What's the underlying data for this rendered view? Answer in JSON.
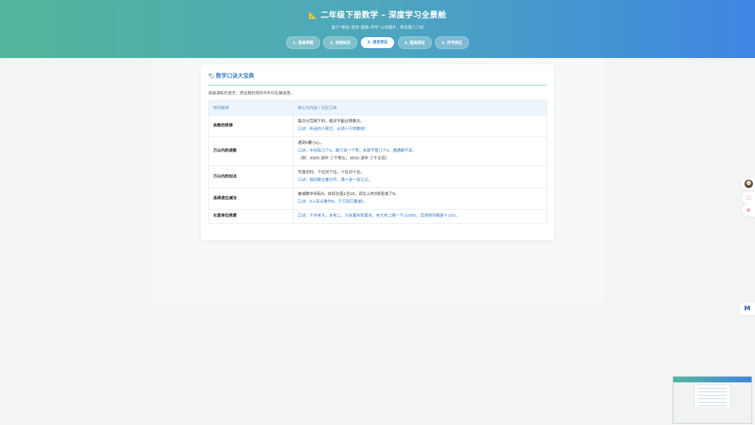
{
  "header": {
    "title": "二年级下册数学 – 深度学习全景舱",
    "subtitle": "基于“体验–语言–图画–符号”认知循环 · 青岛版六三制",
    "tabs": [
      {
        "label": "1. 思维导图",
        "active": false
      },
      {
        "label": "2. 体验知识",
        "active": false
      },
      {
        "label": "3. 语言表征",
        "active": true
      },
      {
        "label": "4. 图画表征",
        "active": false
      },
      {
        "label": "5. 符号表征",
        "active": false
      }
    ]
  },
  "card": {
    "title": "数学口诀大宝典",
    "description": "用最凝练的语言，把运算的规则牢牢印在脑海里。",
    "table": {
      "headers": [
        "知识板块",
        "核心大白话 / 记忆口诀"
      ],
      "rows": [
        {
          "topic": "余数的铁律",
          "lines": [
            {
              "text": "每次分完剩下的，绝对不能比除数大。",
              "rhyme": false
            },
            {
              "text": "口诀：听话的小尾巴，必须小于除数他！",
              "rhyme": true
            }
          ]
        },
        {
          "topic": "万以内的读数",
          "lines": [
            {
              "text": "遇到0要小心。",
              "rhyme": false
            },
            {
              "text": "口诀：中间有几个0，都只读一个零；末尾不管几个0，通通都不读。",
              "rhyme": true
            },
            {
              "text": "（例：3005 读作 三千零五；3500 读作 三千五百）",
              "rhyme": false
            }
          ]
        },
        {
          "topic": "万以内的加法",
          "lines": [
            {
              "text": "写竖式时，个位对个位，十位对十位。",
              "rhyme": false
            },
            {
              "text": "口诀：相同数位要对齐，满十进一别忘记。",
              "rhyme": true
            }
          ]
        },
        {
          "topic": "连续退位减法",
          "lines": [
            {
              "text": "被减数中间有0，向百位借1当10，百位上的0就变成了9。",
              "rhyme": false
            },
            {
              "text": "口诀：0上有点看作9，千万别忘要减1。",
              "rhyme": true
            }
          ]
        },
        {
          "topic": "长度单位换算",
          "lines": [
            {
              "text": "口诀：千米老大，米老二，分米厘米和毫米。老大老二隔一千(1000)，其他相邻都是十(10)。",
              "rhyme": true
            }
          ]
        }
      ]
    }
  },
  "widgets": {
    "logo_text": "M",
    "colors": {
      "accent": "#3f85e2",
      "green": "#52b79a",
      "rhyme": "#2f78c8"
    }
  }
}
